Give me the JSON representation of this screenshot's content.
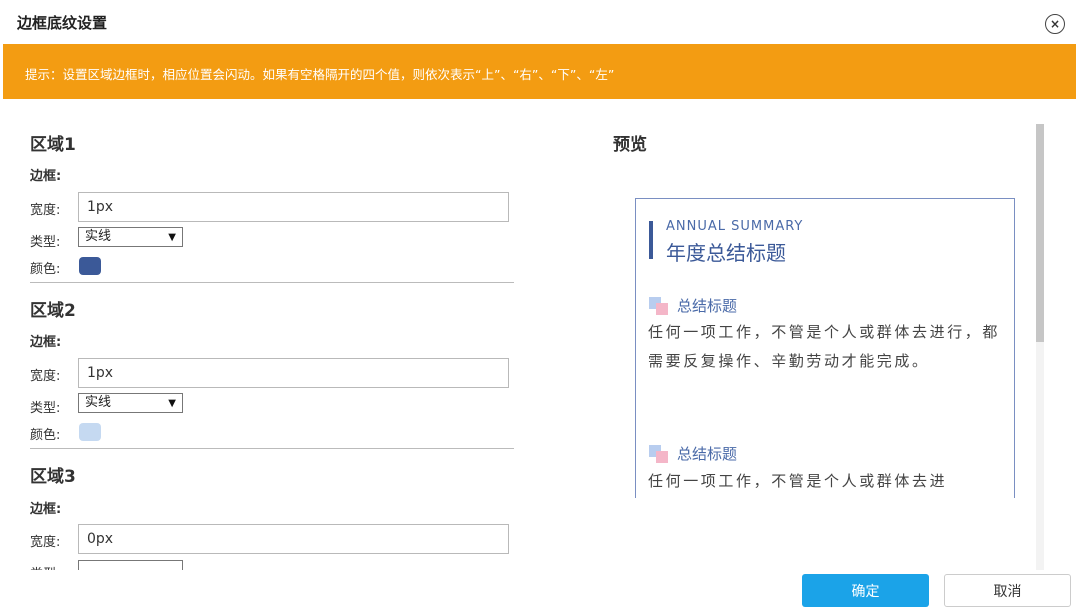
{
  "dialog": {
    "title": "边框底纹设置",
    "close_symbol": "×"
  },
  "notice": {
    "text": "提示：设置区域边框时，相应位置会闪动。如果有空格隔开的四个值，则依次表示“上”、“右”、“下”、“左”"
  },
  "labels": {
    "border": "边框:",
    "width": "宽度:",
    "type": "类型:",
    "color": "颜色:"
  },
  "regions": [
    {
      "title": "区域1",
      "width_value": "1px",
      "type_value": "实线",
      "color": "#3b5998"
    },
    {
      "title": "区域2",
      "width_value": "1px",
      "type_value": "实线",
      "color": "#c5d9f1"
    },
    {
      "title": "区域3",
      "width_value": "0px"
    }
  ],
  "preview": {
    "title": "预览",
    "eyebrow": "ANNUAL SUMMARY",
    "heading": "年度总结标题",
    "items": [
      {
        "title": "总结标题",
        "text": "任何一项工作，不管是个人或群体去进行，都需要反复操作、辛勤劳动才能完成。"
      },
      {
        "title": "总结标题",
        "text": "任何一项工作，不管是个人或群体去进"
      }
    ]
  },
  "buttons": {
    "ok": "确定",
    "cancel": "取消"
  },
  "colors": {
    "accent": "#f39c12",
    "primary": "#1ba3e8",
    "brand": "#3b5998"
  }
}
